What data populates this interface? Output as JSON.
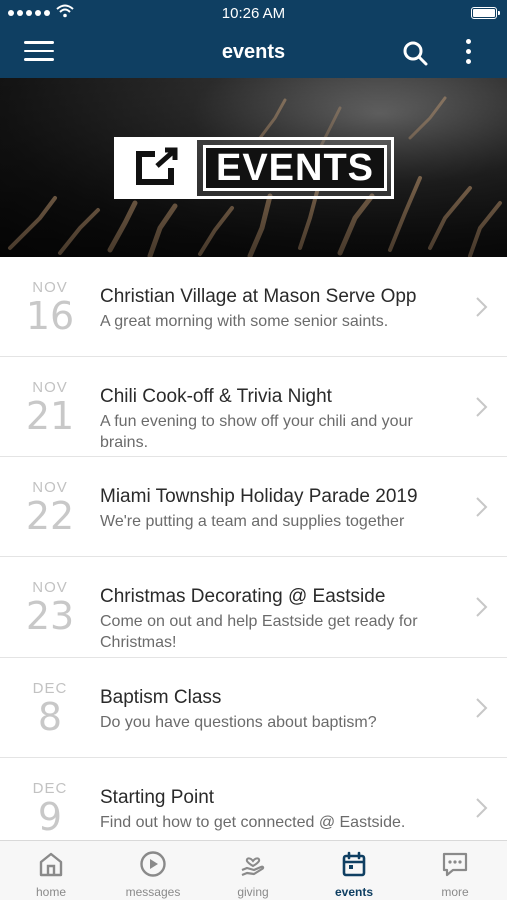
{
  "status_bar": {
    "time": "10:26 AM"
  },
  "header": {
    "title": "events"
  },
  "banner": {
    "logo_text": "EVENTS"
  },
  "events": [
    {
      "month": "NOV",
      "day": "16",
      "title": "Christian Village at Mason Serve Opp",
      "description": "A great morning with some senior saints."
    },
    {
      "month": "NOV",
      "day": "21",
      "title": "Chili Cook-off & Trivia Night",
      "description": "A fun evening to show off your chili and your brains."
    },
    {
      "month": "NOV",
      "day": "22",
      "title": "Miami Township Holiday Parade 2019",
      "description": "We're putting a team and supplies together"
    },
    {
      "month": "NOV",
      "day": "23",
      "title": "Christmas Decorating @ Eastside",
      "description": "Come on out and help Eastside get ready for Christmas!"
    },
    {
      "month": "DEC",
      "day": "8",
      "title": "Baptism Class",
      "description": "Do you have questions about baptism?"
    },
    {
      "month": "DEC",
      "day": "9",
      "title": "Starting Point",
      "description": "Find out how to get connected @ Eastside."
    }
  ],
  "tabs": [
    {
      "label": "home",
      "icon": "home-icon"
    },
    {
      "label": "messages",
      "icon": "play-icon"
    },
    {
      "label": "giving",
      "icon": "giving-hand-icon"
    },
    {
      "label": "events",
      "icon": "calendar-icon",
      "active": true
    },
    {
      "label": "more",
      "icon": "chat-bubble-icon"
    }
  ],
  "colors": {
    "header": "#0f3f62",
    "active_tab": "#0f3f62",
    "inactive_tab": "#8a8a8a",
    "date_gray": "#c2c2c2"
  }
}
